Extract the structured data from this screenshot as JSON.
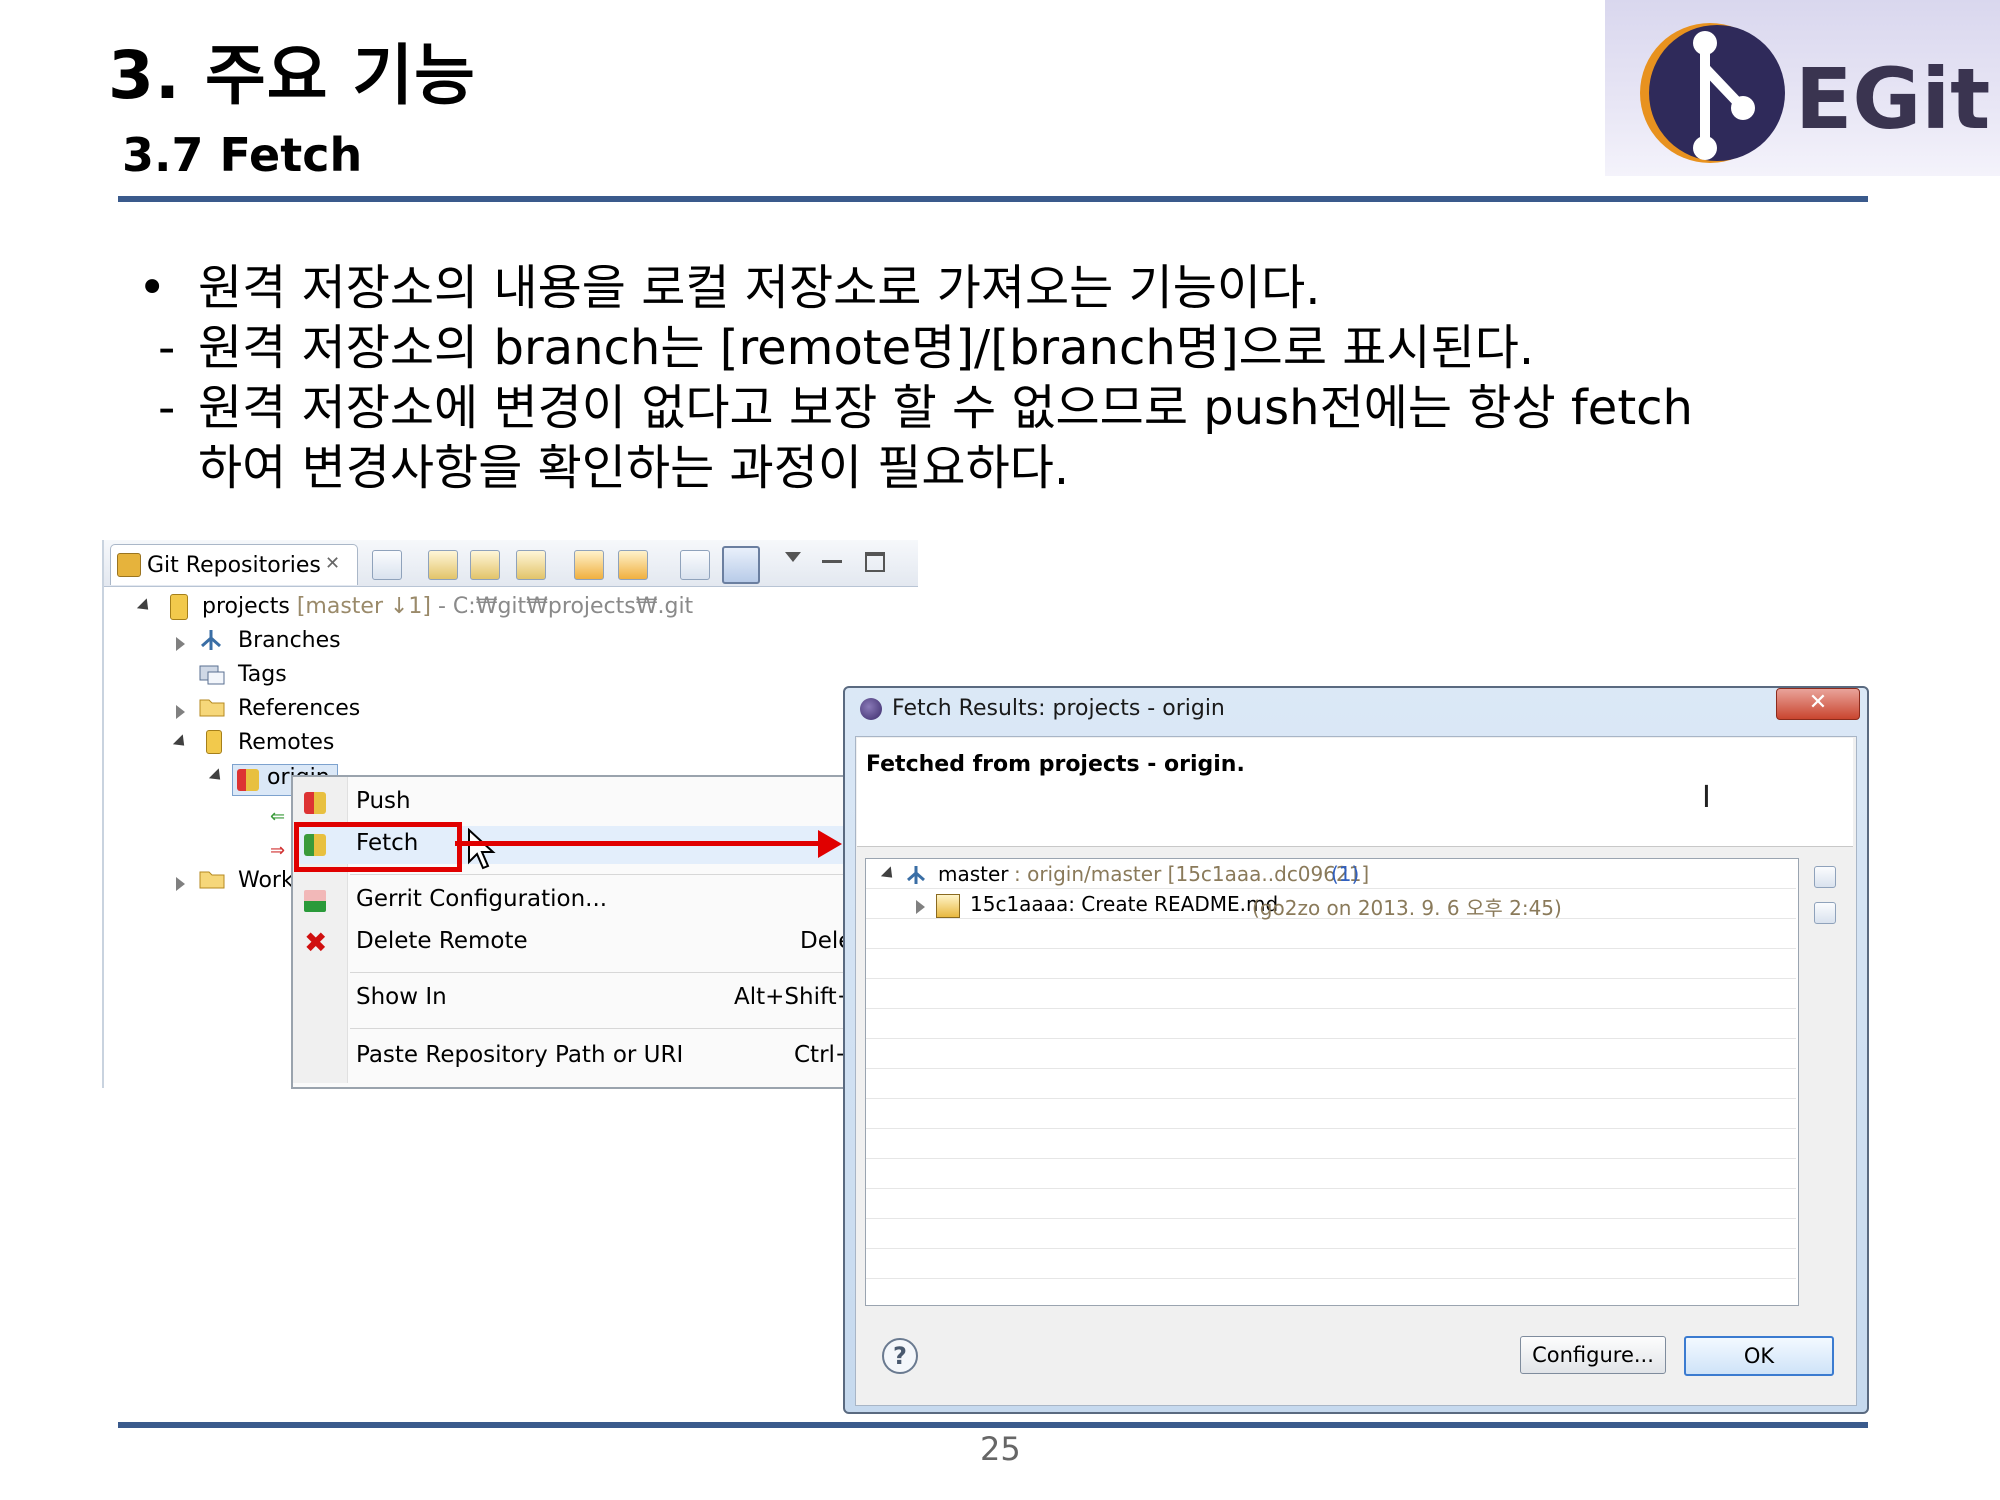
{
  "slide": {
    "title": "3. 주요 기능",
    "subtitle": "3.7 Fetch",
    "logo_text": "EGit",
    "page_number": "25"
  },
  "body": {
    "bullet_symbol": "•",
    "bullet": "원격 저장소의 내용을 로컬 저장소로 가져오는 기능이다.",
    "dash": "-",
    "sub1": "원격 저장소의 branch는 [remote명]/[branch명]으로 표시된다.",
    "sub2_line1": "원격 저장소에 변경이 없다고 보장 할 수 없으므로 push전에는 항상 fetch",
    "sub2_line2": "하여 변경사항을 확인하는 과정이 필요하다."
  },
  "git_repositories": {
    "tab_label": "Git Repositories",
    "tab_close": "✕",
    "repo_name": "projects",
    "repo_branch": "[master ↓1]",
    "repo_path": "- C:₩git₩projects₩.git",
    "tree": {
      "branches": "Branches",
      "tags": "Tags",
      "references": "References",
      "remotes": "Remotes",
      "origin": "origin",
      "working": "Work"
    }
  },
  "context_menu": {
    "push": "Push",
    "fetch": "Fetch",
    "gerrit": "Gerrit Configuration...",
    "delete_remote": "Delete Remote",
    "delete_shortcut": "Dele",
    "show_in": "Show In",
    "show_in_shortcut": "Alt+Shift+\\",
    "paste": "Paste Repository Path or URI",
    "paste_shortcut": "Ctrl+"
  },
  "fetch_dialog": {
    "title": "Fetch Results: projects - origin",
    "close_label": "✕",
    "message": "Fetched from projects - origin.",
    "row1_branch": "master",
    "row1_detail": ": origin/master [15c1aaa..dc09621]",
    "row1_count": "(1)",
    "row2_commit": "15c1aaaa: Create README.md",
    "row2_detail": "(go2zo on 2013. 9. 6 오후 2:45)",
    "configure_button": "Configure...",
    "ok_button": "OK",
    "help_label": "?"
  },
  "colors": {
    "rule": "#3a5a8c",
    "highlight": "#e00000",
    "muted": "#8a7a5a",
    "count_blue": "#3060c0"
  }
}
